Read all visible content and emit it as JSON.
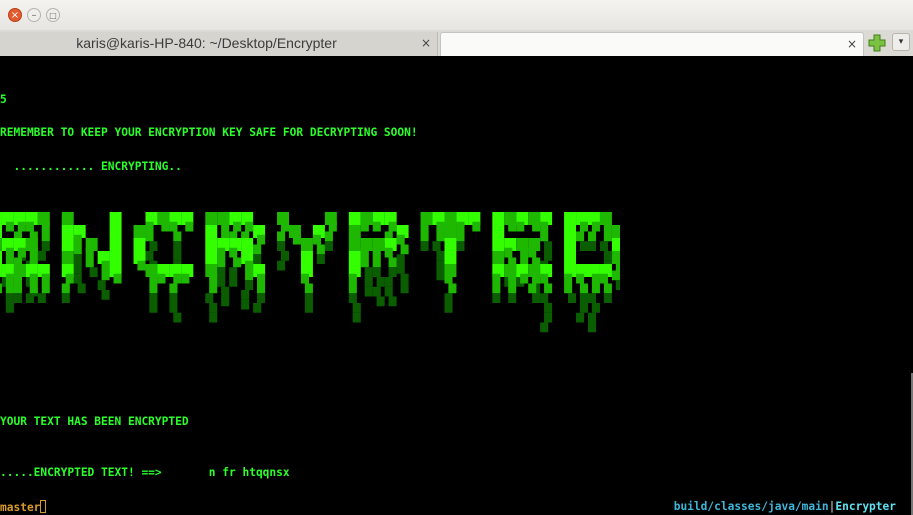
{
  "window": {
    "close_glyph": "×",
    "minimize_glyph": "–",
    "maximize_glyph": "□"
  },
  "tabs": [
    {
      "title": "karis@karis-HP-840: ~/Desktop/Encrypter",
      "close": "×"
    },
    {
      "title": "",
      "close": "×"
    }
  ],
  "toolbar": {
    "add_tab_icon": "plus-icon",
    "menu_glyph": "▾"
  },
  "terminal": {
    "lines": [
      "5",
      "REMEMBER TO KEEP YOUR ENCRYPTION KEY SAFE FOR DECRYPTING SOON!",
      "  ............ ENCRYPTING..",
      "YOUR TEXT HAS BEEN ENCRYPTED",
      ".....ENCRYPTED TEXT! ==>       n fr htqqnsx"
    ],
    "banner_text": "ENCRYPTED",
    "colors": {
      "text": "#2aff2a",
      "banner_bright": "#33ff00",
      "banner_mid": "#1fb800",
      "banner_dark": "#0b5e00"
    }
  },
  "statusbar": {
    "branch": "master",
    "path": "build/classes/java/main",
    "separator": "|",
    "project": "Encrypter"
  }
}
